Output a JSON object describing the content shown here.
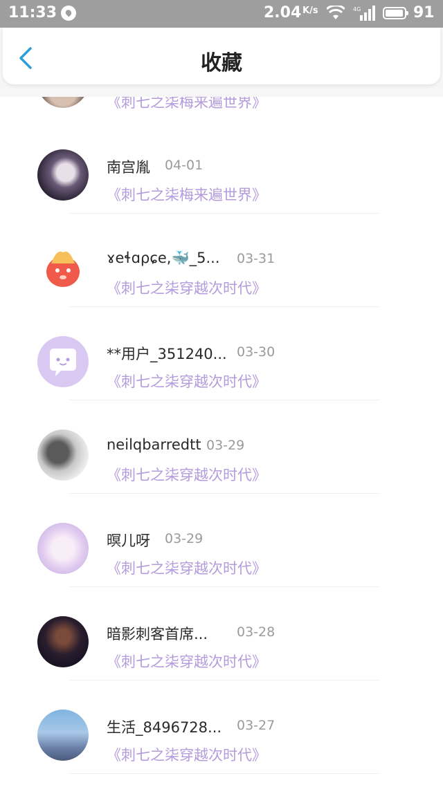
{
  "status_bar": {
    "time": "11:33",
    "speed": "2.04",
    "speed_unit": "K/s",
    "network": "4G",
    "battery": "91"
  },
  "header": {
    "back_icon": "chevron-left-icon",
    "title": "收藏",
    "accent_color": "#2a9fd8"
  },
  "partial_item": {
    "book": "《刺七之柒梅来遍世界》"
  },
  "items": [
    {
      "name": "南宫胤",
      "date": "04-01",
      "book": "《刺七之柒梅来遍世界》"
    },
    {
      "name": "ɤeɬɑρɕe,🐳_5...",
      "date": "03-31",
      "book": "《刺七之柒穿越次时代》"
    },
    {
      "name": "**用户_351240...",
      "date": "03-30",
      "book": "《刺七之柒穿越次时代》"
    },
    {
      "name": "neilqbarredtt",
      "date": "03-29",
      "book": "《刺七之柒穿越次时代》"
    },
    {
      "name": "暝儿呀",
      "date": "03-29",
      "book": "《刺七之柒穿越次时代》"
    },
    {
      "name": "暗影刺客首席...",
      "date": "03-28",
      "book": "《刺七之柒穿越次时代》"
    },
    {
      "name": "生活_8496728...",
      "date": "03-27",
      "book": "《刺七之柒穿越次时代》"
    }
  ],
  "book_color": "#b39bdc"
}
